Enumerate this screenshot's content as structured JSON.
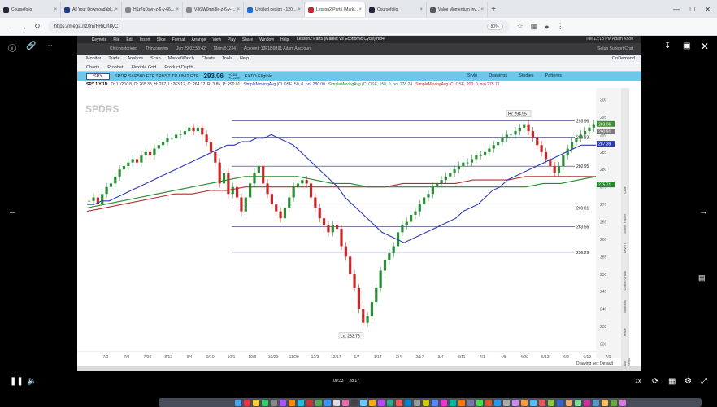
{
  "browser": {
    "tabs": [
      {
        "label": "Coursefolio",
        "color": "#223"
      },
      {
        "label": "All Your Downloadable Fi...",
        "color": "#1a3a8a"
      },
      {
        "label": "H6z7qDsvrl-z-6-y-66630bff...",
        "color": "#888"
      },
      {
        "label": "V3j9W0mn8le-z-6-y-66630...",
        "color": "#888"
      },
      {
        "label": "Untitled design - 1200 x...",
        "color": "#1b6edb"
      },
      {
        "label": "Lesson2 Part5 (Market Vs E...",
        "sub": "PLAYING",
        "color": "#d2232a",
        "active": true
      },
      {
        "label": "Coursefolio",
        "color": "#223"
      },
      {
        "label": "Value Momentum Investi...",
        "color": "#555"
      }
    ],
    "new_tab": "+",
    "url": "https://mega.nz/fm/FRiCn8yC",
    "zoom": "80%"
  },
  "mac": {
    "menu": [
      "Keynote",
      "File",
      "Edit",
      "Insert",
      "Slide",
      "Format",
      "Arrange",
      "View",
      "Play",
      "Share",
      "Window",
      "Help"
    ],
    "window_title": "Lesson2 Part5 (Market Vs Economic Cycle).mp4",
    "clock": "Tue 12:13 PM  Adam Khoo",
    "sub_items": [
      "Chronostoriesd",
      "Thinkorswim",
      "Jun 29 02:53:42",
      "Main@1234",
      "Account: 13F1B6B91 Adam Aaccount"
    ],
    "sub_right": "Setup    Support    Chat"
  },
  "tos": {
    "menu": [
      "Monitor",
      "Trade",
      "Analyze",
      "Scan",
      "MarketWatch",
      "Charts",
      "Tools",
      "Help"
    ],
    "ondemand": "OnDemand",
    "submenu": [
      "Charts",
      "Prophet",
      "Flexible Grid",
      "Product Depth"
    ],
    "symbol": "SPY",
    "desc": "SPDR S&P500 ETF TRUST TR UNIT ETF",
    "price": "293.06",
    "change": "+0.64",
    "change_pct": "+0.22%",
    "exto": "EXTO Eligible",
    "tools": [
      "Style",
      "Drawings",
      "Studies",
      "Patterns"
    ],
    "study_line": {
      "head": "SPY 1 Y 1D",
      "ohlc": "D: 11/20/18, O: 265.38, H: 267, L: 263.12, C: 264.12, R: 3.85, P: 290.01",
      "sma50": "SimpleMovingAvg (CLOSE, 50, 0, no) 280.00",
      "sma150": "SimpleMovingAvg (CLOSE, 150, 0, no) 278.24",
      "sma200": "SimpleMovingAvg (CLOSE, 200, 0, no) 275.71"
    },
    "drawing_set": "Drawing set: Default",
    "side_labels": [
      "Chart",
      "Active Trader",
      "Level II",
      "Option Chain",
      "Watchlist",
      "Trade",
      "Live News"
    ]
  },
  "chart_data": {
    "type": "candlestick",
    "symbol": "SPY",
    "period": "1 Y 1D",
    "x_tick_labels": [
      "7/2",
      "7/9",
      "7/30",
      "8/13",
      "9/4",
      "9/10",
      "10/1",
      "10/8",
      "10/29",
      "11/20",
      "12/3",
      "12/17",
      "1/7",
      "1/14",
      "2/4",
      "2/17",
      "3/4",
      "3/11",
      "4/1",
      "4/8",
      "4/29",
      "5/13",
      "6/3",
      "6/19",
      "7/1"
    ],
    "y_tick_labels": [
      "300",
      "295",
      "290",
      "285",
      "280",
      "275",
      "270",
      "265",
      "260",
      "255",
      "250",
      "245",
      "240",
      "235",
      "230"
    ],
    "ylim": [
      228,
      302
    ],
    "annotations": {
      "high": "Hi: 294.95",
      "low": "Lo: 233.76"
    },
    "horizontal_levels": [
      {
        "value": 293.96,
        "label": "293.96"
      },
      {
        "value": 289.33,
        "label": "289.33"
      },
      {
        "value": 280.95,
        "label": "280.95"
      },
      {
        "value": 269.01,
        "label": "269.01"
      },
      {
        "value": 263.56,
        "label": "263.56"
      },
      {
        "value": 256.29,
        "label": "256.29"
      }
    ],
    "price_bubbles": [
      {
        "value": 293.06,
        "label": "293.06",
        "color": "#3a8f3a"
      },
      {
        "value": 290.91,
        "label": "290.91",
        "color": "#7a7a7a"
      },
      {
        "value": 287.39,
        "label": "287.39",
        "color": "#2a3ab5"
      },
      {
        "value": 275.71,
        "label": "275.71",
        "color": "#238a2a"
      }
    ],
    "closes": [
      271,
      272,
      270,
      273,
      275,
      276,
      278,
      280,
      281,
      282,
      283,
      282,
      284,
      285,
      284,
      286,
      287,
      288,
      289,
      289,
      290,
      290,
      291,
      292,
      291,
      292,
      290,
      288,
      285,
      282,
      276,
      279,
      273,
      275,
      272,
      268,
      272,
      276,
      279,
      281,
      276,
      273,
      270,
      268,
      266,
      269,
      272,
      275,
      276,
      277,
      276,
      272,
      269,
      266,
      264,
      262,
      264,
      263,
      258,
      255,
      250,
      246,
      240,
      236,
      238,
      242,
      246,
      251,
      254,
      256,
      258,
      262,
      264,
      265,
      267,
      268,
      270,
      272,
      273,
      275,
      276,
      277,
      278,
      279,
      280,
      281,
      282,
      282,
      283,
      284,
      284,
      285,
      286,
      287,
      288,
      289,
      290,
      290,
      291,
      292,
      293,
      291,
      289,
      287,
      285,
      283,
      281,
      279,
      281,
      284,
      286,
      288,
      289,
      290,
      291,
      292,
      293
    ],
    "sma50": [
      270,
      270,
      271,
      271,
      272,
      273,
      274,
      275,
      276,
      277,
      278,
      279,
      280,
      281,
      282,
      283,
      284,
      285,
      286,
      287,
      287,
      288,
      288,
      289,
      289,
      290,
      289,
      288,
      287,
      285,
      283,
      281,
      279,
      277,
      275,
      272,
      270,
      268,
      266,
      264,
      262,
      261,
      260,
      259,
      260,
      261,
      262,
      263,
      264,
      265,
      266,
      268,
      269,
      270,
      272,
      274,
      275,
      277,
      278,
      279,
      280,
      281,
      282,
      283,
      284,
      285,
      286,
      287,
      287,
      287
    ],
    "sma150": [
      269,
      270,
      271,
      272,
      273,
      274,
      275,
      276,
      277,
      278,
      278,
      278,
      278,
      277,
      276,
      276,
      275,
      275,
      275,
      275,
      275,
      275,
      275,
      275,
      275,
      275,
      276,
      276,
      277,
      278
    ],
    "sma200": [
      268,
      269,
      270,
      271,
      272,
      273,
      273,
      274,
      274,
      275,
      275,
      275,
      275,
      275,
      275,
      275,
      275,
      275,
      276,
      276,
      276,
      276,
      277,
      277,
      277,
      278,
      278,
      278,
      278,
      278
    ]
  },
  "player": {
    "time_left": "00:33",
    "time_right": "28:17",
    "speed": "1x"
  }
}
